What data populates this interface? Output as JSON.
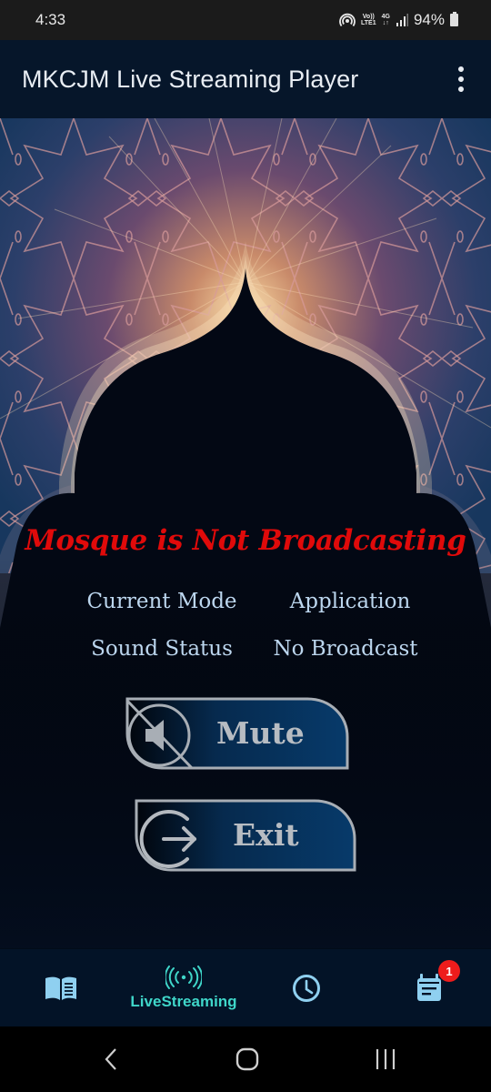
{
  "status_bar": {
    "time": "4:33",
    "hotspot_icon": "hotspot-icon",
    "volte_label_top": "Vo))",
    "volte_label_bottom": "LTE1",
    "network_label": "4G",
    "network_arrows": "↓↑",
    "signal_icon": "signal-bars-icon",
    "battery_percent": "94%",
    "battery_icon": "battery-icon"
  },
  "app_bar": {
    "title": "MKCJM Live Streaming Player",
    "menu_icon": "more-vert-icon"
  },
  "main": {
    "background": "mosque-dome-silhouette-with-islamic-pattern",
    "headline": "Mosque is Not Broadcasting",
    "headline_color": "#e00a0a",
    "info": [
      {
        "label": "Current Mode",
        "value": "Application"
      },
      {
        "label": "Sound Status",
        "value": "No Broadcast"
      }
    ],
    "buttons": [
      {
        "label": "Mute",
        "icon": "volume-off-icon"
      },
      {
        "label": "Exit",
        "icon": "exit-arrow-icon"
      }
    ]
  },
  "bottom_nav": {
    "active_color": "#3fd6c9",
    "icon_color": "#8fd0f0",
    "items": [
      {
        "id": "reader",
        "icon": "book-icon",
        "label": ""
      },
      {
        "id": "live",
        "icon": "broadcast-icon",
        "label": "LiveStreaming",
        "active": true
      },
      {
        "id": "schedule",
        "icon": "clock-icon",
        "label": ""
      },
      {
        "id": "events",
        "icon": "calendar-icon",
        "label": "",
        "badge": "1"
      }
    ]
  },
  "system_nav": {
    "back": "back-icon",
    "home": "home-icon",
    "recents": "recents-icon"
  }
}
